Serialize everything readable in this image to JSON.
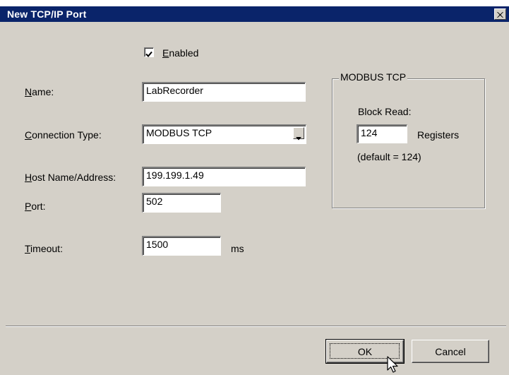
{
  "window": {
    "title": "New TCP/IP Port",
    "close_glyph": "✕"
  },
  "enabled": {
    "label": "Enabled",
    "accel": "E",
    "checked": true
  },
  "name": {
    "label": "Name:",
    "accel": "N",
    "value": "LabRecorder"
  },
  "connection_type": {
    "label": "Connection Type:",
    "accel": "C",
    "selected": "MODBUS TCP"
  },
  "host": {
    "label": "Host Name/Address:",
    "accel": "H",
    "value": "199.199.1.49"
  },
  "port": {
    "label": "Port:",
    "accel": "P",
    "value": "502"
  },
  "timeout": {
    "label": "Timeout:",
    "accel": "T",
    "value": "1500",
    "unit": "ms"
  },
  "modbus_group": {
    "title": "MODBUS TCP",
    "block_read_label": "Block Read:",
    "block_read_value": "124",
    "registers_label": "Registers",
    "default_note": "(default = 124)"
  },
  "buttons": {
    "ok": "OK",
    "cancel": "Cancel"
  },
  "icons": [
    "close-icon",
    "checkmark-icon",
    "dropdown-arrow-icon",
    "mouse-cursor-icon"
  ]
}
